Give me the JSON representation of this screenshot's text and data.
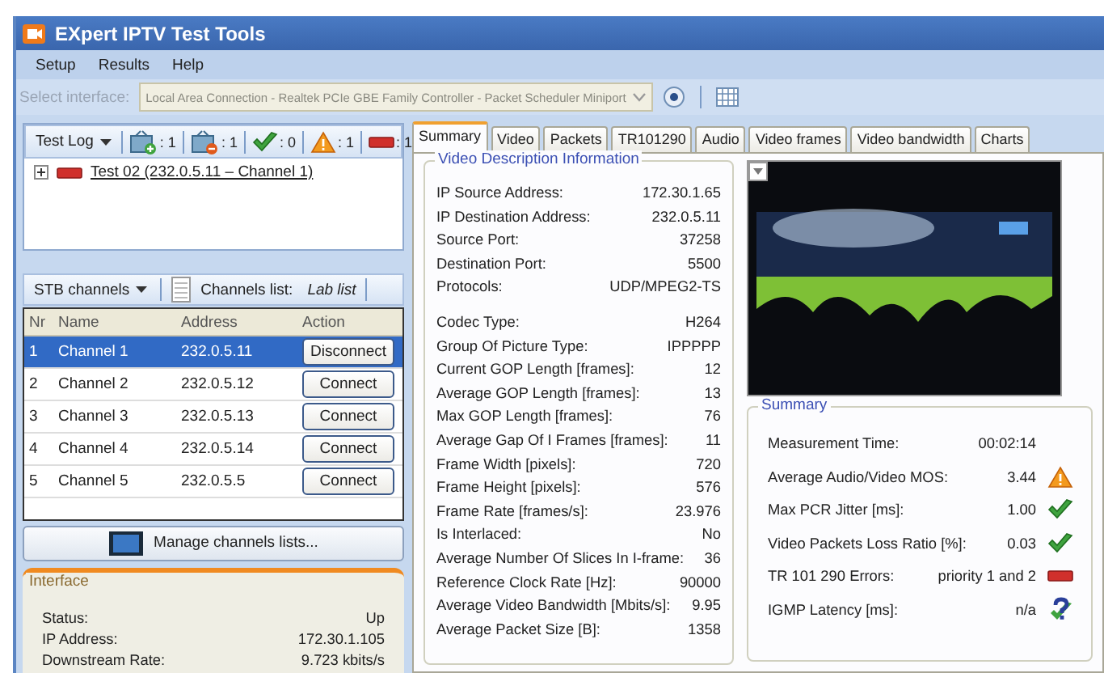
{
  "window": {
    "title": "EXpert IPTV Test Tools"
  },
  "menu": [
    "Setup",
    "Results",
    "Help"
  ],
  "interface_bar": {
    "label": "Select interface:",
    "value": "Local Area Connection - Realtek PCIe GBE Family Controller - Packet Scheduler Miniport",
    "disabled": true
  },
  "test_log": {
    "label": "Test Log",
    "counters": [
      {
        "kind": "tv-ok",
        "count": ": 1"
      },
      {
        "kind": "tv-error",
        "count": ": 1"
      },
      {
        "kind": "ok",
        "count": ": 0"
      },
      {
        "kind": "warning",
        "count": ": 1"
      },
      {
        "kind": "error",
        "count": ": 1"
      }
    ],
    "tree": [
      {
        "label": "Test 02 (232.0.5.11 – Channel 1)",
        "kind": "error",
        "expanded": false
      }
    ]
  },
  "channels": {
    "menu_label": "STB channels",
    "list_label": "Channels list:",
    "list_name": "Lab list",
    "columns": [
      "Nr",
      "Name",
      "Address",
      "Action"
    ],
    "rows": [
      {
        "nr": "1",
        "name": "Channel 1",
        "address": "232.0.5.11",
        "action": "Disconnect",
        "selected": true
      },
      {
        "nr": "2",
        "name": "Channel 2",
        "address": "232.0.5.12",
        "action": "Connect",
        "selected": false
      },
      {
        "nr": "3",
        "name": "Channel 3",
        "address": "232.0.5.13",
        "action": "Connect",
        "selected": false
      },
      {
        "nr": "4",
        "name": "Channel 4",
        "address": "232.0.5.14",
        "action": "Connect",
        "selected": false
      },
      {
        "nr": "5",
        "name": "Channel 5",
        "address": "232.0.5.5",
        "action": "Connect",
        "selected": false
      }
    ],
    "manage_button": "Manage channels lists..."
  },
  "interface": {
    "title": "Interface",
    "rows": [
      {
        "label": "Status:",
        "value": "Up"
      },
      {
        "label": "IP Address:",
        "value": "172.30.1.105"
      },
      {
        "label": "Downstream Rate:",
        "value": "9.723 kbits/s"
      }
    ]
  },
  "tabs": [
    {
      "label": "Summary",
      "selected": true
    },
    {
      "label": "Video",
      "selected": false
    },
    {
      "label": "Packets",
      "selected": false
    },
    {
      "label": "TR101290",
      "selected": false
    },
    {
      "label": "Audio",
      "selected": false
    },
    {
      "label": "Video frames",
      "selected": false
    },
    {
      "label": "Video bandwidth",
      "selected": false
    },
    {
      "label": "Charts",
      "selected": false
    }
  ],
  "video_info": {
    "title": "Video Description Information",
    "groups": [
      [
        {
          "label": "IP Source Address:",
          "value": "172.30.1.65"
        },
        {
          "label": "IP Destination Address:",
          "value": "232.0.5.11"
        },
        {
          "label": "Source Port:",
          "value": "37258"
        },
        {
          "label": "Destination Port:",
          "value": "5500"
        },
        {
          "label": "Protocols:",
          "value": "UDP/MPEG2-TS"
        }
      ],
      [
        {
          "label": "Codec Type:",
          "value": "H264"
        },
        {
          "label": "Group Of Picture Type:",
          "value": "IPPPPP"
        },
        {
          "label": "Current GOP Length [frames]:",
          "value": "12"
        },
        {
          "label": "Average GOP Length [frames]:",
          "value": "13"
        },
        {
          "label": "Max GOP Length [frames]:",
          "value": "76"
        },
        {
          "label": "Average Gap Of I Frames [frames]:",
          "value": "11"
        },
        {
          "label": "Frame Width [pixels]:",
          "value": "720"
        },
        {
          "label": "Frame Height [pixels]:",
          "value": "576"
        },
        {
          "label": "Frame Rate [frames/s]:",
          "value": "23.976"
        },
        {
          "label": "Is Interlaced:",
          "value": "No"
        },
        {
          "label": "Average Number Of Slices In I-frame:",
          "value": "36"
        },
        {
          "label": "Reference Clock Rate [Hz]:",
          "value": "90000"
        },
        {
          "label": "Average Video Bandwidth [Mbits/s]:",
          "value": "9.95"
        },
        {
          "label": "Average Packet Size [B]:",
          "value": "1358"
        }
      ]
    ]
  },
  "summary": {
    "title": "Summary",
    "rows": [
      {
        "label": "Measurement Time:",
        "value": "00:02:14"
      },
      {
        "label": "Average Audio/Video MOS:",
        "value": "3.44",
        "kind": "warning"
      },
      {
        "label": "Max PCR Jitter [ms]:",
        "value": "1.00",
        "kind": "ok"
      },
      {
        "label": "Video Packets Loss Ratio [%]:",
        "value": "0.03",
        "kind": "ok"
      },
      {
        "label": "TR 101 290 Errors:",
        "value": "priority 1 and 2",
        "kind": "error"
      },
      {
        "label": "IGMP Latency [ms]:",
        "value": "n/a",
        "kind": "unknown"
      }
    ]
  }
}
